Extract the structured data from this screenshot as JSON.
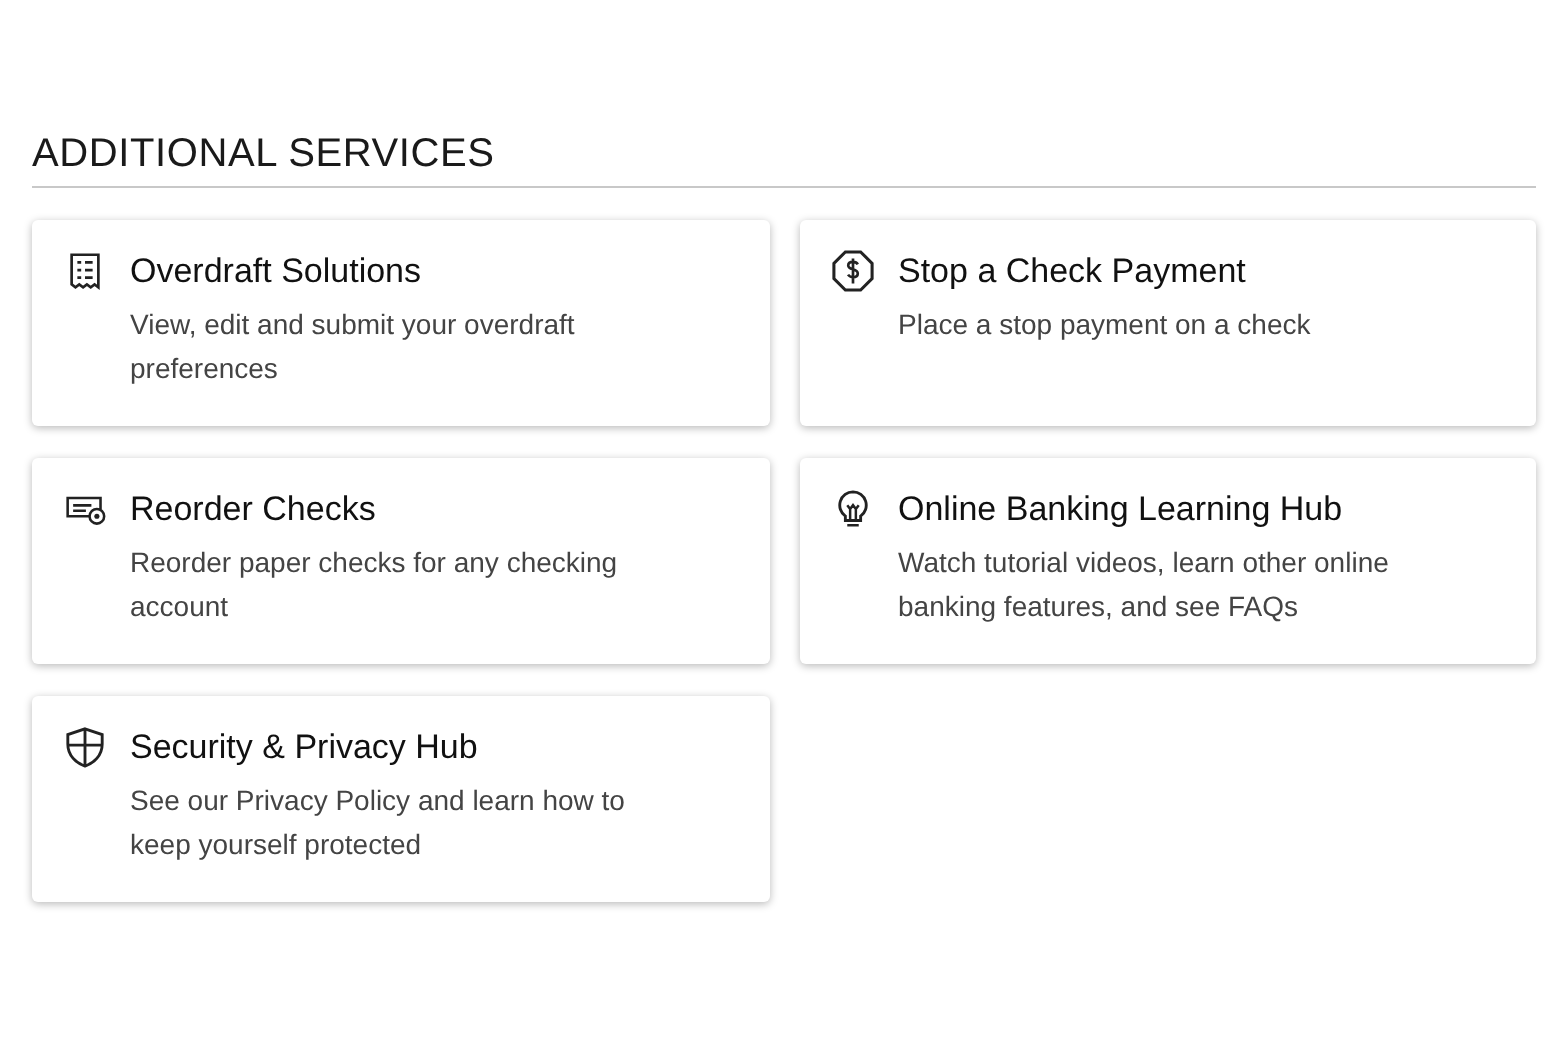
{
  "section": {
    "title": "ADDITIONAL SERVICES"
  },
  "cards": [
    {
      "title": "Overdraft Solutions",
      "description": "View, edit and submit your overdraft preferences"
    },
    {
      "title": "Stop a Check Payment",
      "description": "Place a stop payment on a check"
    },
    {
      "title": "Reorder Checks",
      "description": "Reorder paper checks for any checking account"
    },
    {
      "title": "Online Banking Learning Hub",
      "description": "Watch tutorial videos, learn other online banking features, and see FAQs"
    },
    {
      "title": "Security & Privacy Hub",
      "description": "See our Privacy Policy and learn how to keep yourself protected"
    }
  ]
}
